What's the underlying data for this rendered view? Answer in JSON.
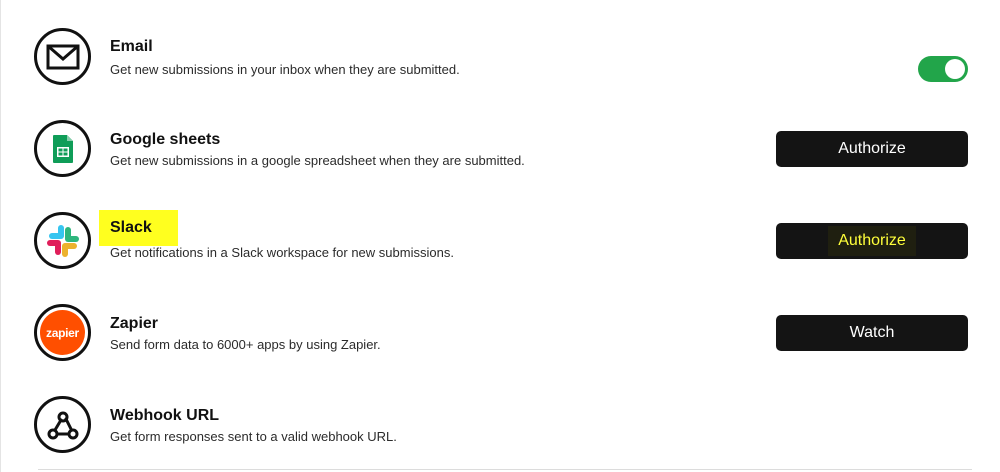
{
  "integrations": [
    {
      "id": "email",
      "icon": "envelope-icon",
      "title": "Email",
      "description": "Get new submissions in your inbox when they are submitted.",
      "control": "toggle",
      "enabled": true
    },
    {
      "id": "google-sheets",
      "icon": "google-sheets-icon",
      "title": "Google sheets",
      "description": "Get new submissions in a google spreadsheet when they are submitted.",
      "control": "button",
      "button_label": "Authorize"
    },
    {
      "id": "slack",
      "icon": "slack-icon",
      "title": "Slack",
      "description": "Get notifications in a Slack workspace for new submissions.",
      "control": "button",
      "button_label": "Authorize"
    },
    {
      "id": "zapier",
      "icon": "zapier-icon",
      "icon_text": "zapier",
      "title": "Zapier",
      "description": "Send form data to 6000+ apps by using Zapier.",
      "control": "button",
      "button_label": "Watch"
    },
    {
      "id": "webhook",
      "icon": "webhook-icon",
      "title": "Webhook URL",
      "description": "Get form responses sent to a valid webhook URL."
    }
  ],
  "colors": {
    "toggle_on": "#22a54a",
    "button_bg": "#141414",
    "highlight": "#ffff1f",
    "zapier_orange": "#ff4f00",
    "sheets_green": "#0f9d58"
  }
}
